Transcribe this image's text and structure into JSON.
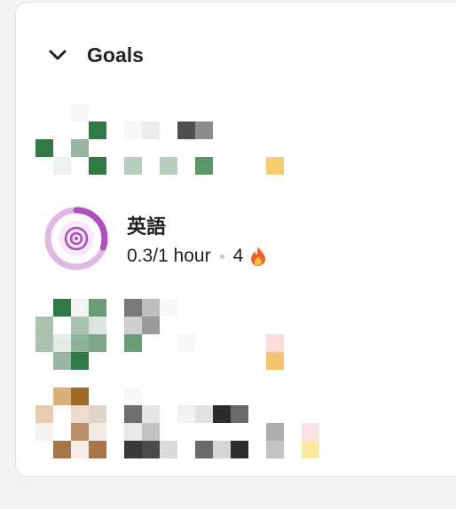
{
  "section": {
    "title": "Goals",
    "collapse_icon": "chevron-down-icon"
  },
  "goal": {
    "name": "英語",
    "progress_text": "0.3/1 hour",
    "progress_fraction": 0.3,
    "streak": "4",
    "streak_icon": "fire-icon",
    "goal_icon": "target-icon"
  },
  "colors": {
    "ring_track": "#e3b6e5",
    "ring_fill": "#b04cc0",
    "ring_center": "#f6e9f8",
    "ring_icon": "#b04cc0"
  }
}
